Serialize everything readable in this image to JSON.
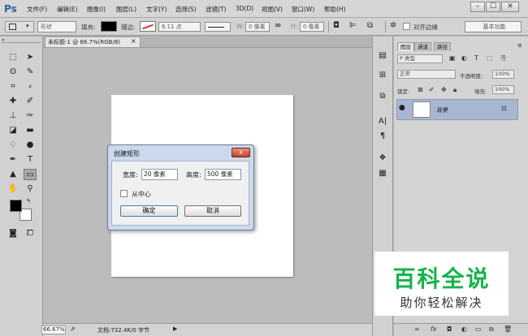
{
  "app": {
    "logo": "Ps"
  },
  "menu": [
    "文件(F)",
    "编辑(E)",
    "图像(I)",
    "图层(L)",
    "文字(Y)",
    "选择(S)",
    "滤镜(T)",
    "3D(D)",
    "视图(V)",
    "窗口(W)",
    "帮助(H)"
  ],
  "window_buttons": {
    "minimize": "–",
    "restore": "☐",
    "close": "✕"
  },
  "options": {
    "mode_value": "形状",
    "fill_label": "填充:",
    "stroke_label": "描边:",
    "stroke_size": "6.11 点",
    "w_label": "W:",
    "w_value": "0 像素",
    "link_icon": "∞",
    "h_label": "H:",
    "h_value": "0 像素",
    "align_edges_label": "对齐边缘",
    "workspace": "基本功能"
  },
  "document": {
    "tab_title": "未标题-1 @ 66.7%(RGB/8)",
    "tab_close": "×",
    "zoom": "66.67%",
    "info": "文档:732.4K/0 字节"
  },
  "dialog": {
    "title": "创建矩形",
    "close": "x",
    "width_label": "宽度:",
    "width_value": "20 像素",
    "height_label": "高度:",
    "height_value": "500 像素",
    "from_center_label": "从中心",
    "ok_label": "确定",
    "cancel_label": "取消"
  },
  "layers_panel": {
    "tabs": [
      "图层",
      "通道",
      "路径"
    ],
    "kind_filter": "P 类型",
    "blend_mode": "正常",
    "opacity_label": "不透明度:",
    "opacity_value": "100%",
    "lock_label": "锁定:",
    "fill_label": "填充:",
    "fill_value": "100%",
    "layer_name": "背景"
  },
  "watermark": {
    "title": "百科全说",
    "subtitle": "助你轻松解决"
  },
  "colors": {
    "accent": "#2b5fa5",
    "dialog_frame": "#c9daee",
    "close_red": "#c1432a",
    "watermark_green": "#15b34a",
    "layer_selected": "#a8b6d2"
  }
}
